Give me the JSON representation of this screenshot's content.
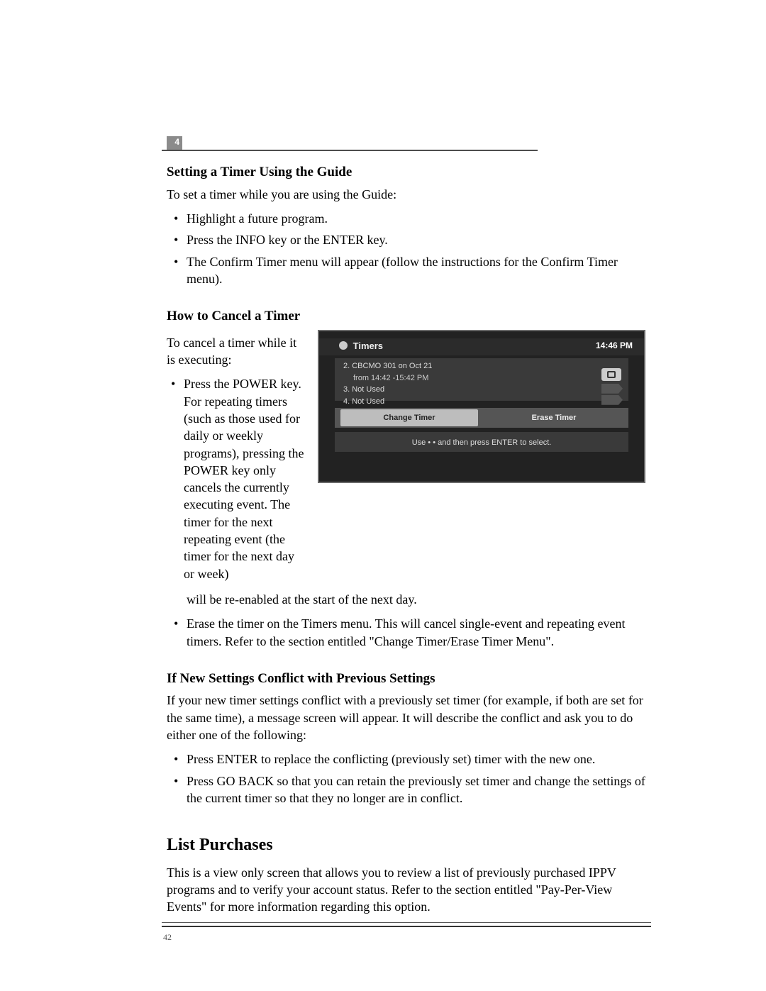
{
  "chapter_number": "4",
  "page_number": "42",
  "sections": {
    "s1": {
      "heading": "Setting a Timer Using the Guide",
      "intro": "To set a timer while you are using the Guide:",
      "bullets": [
        "Highlight a future program.",
        "Press the INFO key or the ENTER key.",
        "The Confirm Timer menu will appear (follow the instructions for the Confirm Timer menu)."
      ]
    },
    "s2": {
      "heading": "How to Cancel a Timer",
      "intro": "To cancel a timer while it is executing:",
      "bullet1_part1": "Press the POWER key. For repeating timers (such as those used for daily or weekly programs), pressing the POWER key only cancels the currently executing event. The timer for the next repeating event (the timer for the next day or week)",
      "bullet1_part2": "will be re-enabled at the start of the next day.",
      "bullet2": "Erase the timer on the Timers menu. This will cancel single-event and repeating event timers. Refer to the section entitled \"Change Timer/Erase Timer Menu\"."
    },
    "s3": {
      "heading": "If New Settings Conflict with Previous Settings",
      "intro": "If your new timer settings conflict with a previously set timer (for example, if both are set for the same time), a message screen will appear. It will describe the conflict and ask you to do either one of the following:",
      "bullets": [
        "Press ENTER to replace the conflicting (previously set) timer with the new one.",
        "Press GO BACK so that you can retain the previously set timer and change the settings of the current timer so that they no longer are in conflict."
      ]
    },
    "s4": {
      "heading": "List Purchases",
      "body": "This is a view only screen that allows you to review a list of previously purchased IPPV programs and to verify your account status. Refer to the section entitled \"Pay-Per-View Events\" for more information regarding this option."
    }
  },
  "timers_screenshot": {
    "title": "Timers",
    "clock": "14:46 PM",
    "rows": {
      "r2a": "2. CBCMO 301 on Oct 21",
      "r2b": "from 14:42 -15:42 PM",
      "r3": "3. Not Used",
      "r4": "4. Not Used"
    },
    "btn_change": "Change Timer",
    "btn_erase": "Erase Timer",
    "hint": "Use • • and then press ENTER to select."
  }
}
